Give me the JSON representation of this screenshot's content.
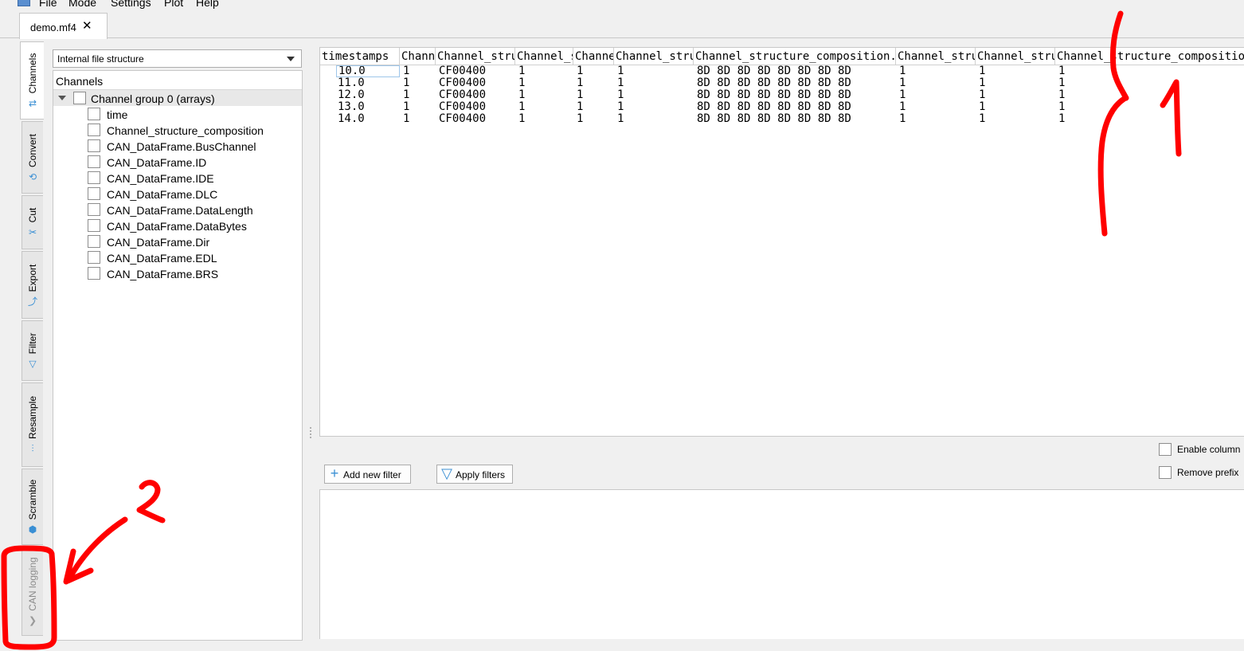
{
  "menu": {
    "items": [
      "File",
      "Mode",
      "Settings",
      "Plot",
      "Help"
    ]
  },
  "document_tab": {
    "title": "demo.mf4",
    "close_glyph": "✕"
  },
  "side_tabs": [
    {
      "label": "Channels",
      "icon": "channels-icon",
      "glyph": "⇄"
    },
    {
      "label": "Convert",
      "icon": "convert-icon",
      "glyph": "⟲"
    },
    {
      "label": "Cut",
      "icon": "scissors-icon",
      "glyph": "✂"
    },
    {
      "label": "Export",
      "icon": "export-icon",
      "glyph": "⤴"
    },
    {
      "label": "Filter",
      "icon": "filter-icon",
      "glyph": "▽"
    },
    {
      "label": "Resample",
      "icon": "resample-icon",
      "glyph": "⫶"
    },
    {
      "label": "Scramble",
      "icon": "scramble-icon",
      "glyph": "⬢"
    },
    {
      "label": "CAN logging",
      "icon": "chevron-icon",
      "glyph": "❯"
    }
  ],
  "left_panel": {
    "combo_value": "Internal file structure",
    "tree_header": "Channels",
    "group_label": "Channel group 0 (arrays)",
    "channels": [
      "time",
      "Channel_structure_composition",
      "CAN_DataFrame.BusChannel",
      "CAN_DataFrame.ID",
      "CAN_DataFrame.IDE",
      "CAN_DataFrame.DLC",
      "CAN_DataFrame.DataLength",
      "CAN_DataFrame.DataBytes",
      "CAN_DataFrame.Dir",
      "CAN_DataFrame.EDL",
      "CAN_DataFrame.BRS"
    ]
  },
  "table": {
    "columns": [
      "timestamps",
      "Channel_structure_composition.CAN_DataFrame.BusChannel",
      "Channel_structure_composition.CAN_DataFrame.ID",
      "Channel_structure_composition.CAN_DataFrame.IDE",
      "Channel_structure_composition.CAN_DataFrame.DLC",
      "Channel_structure_composition.CAN_DataFrame.DataLength",
      "Channel_structure_composition.CAN_DataFrame.DataBytes",
      "Channel_structure_composition.CAN_DataFrame.Dir",
      "Channel_structure_composition.CAN_DataFrame.EDL",
      "Channel_structure_composition.CAN_DataFrame.BRS"
    ],
    "rows": [
      [
        "10.0",
        "1",
        "CF00400",
        "1",
        "1",
        "1",
        "8D 8D 8D 8D 8D 8D 8D 8D",
        "1",
        "1",
        "1"
      ],
      [
        "11.0",
        "1",
        "CF00400",
        "1",
        "1",
        "1",
        "8D 8D 8D 8D 8D 8D 8D 8D",
        "1",
        "1",
        "1"
      ],
      [
        "12.0",
        "1",
        "CF00400",
        "1",
        "1",
        "1",
        "8D 8D 8D 8D 8D 8D 8D 8D",
        "1",
        "1",
        "1"
      ],
      [
        "13.0",
        "1",
        "CF00400",
        "1",
        "1",
        "1",
        "8D 8D 8D 8D 8D 8D 8D 8D",
        "1",
        "1",
        "1"
      ],
      [
        "14.0",
        "1",
        "CF00400",
        "1",
        "1",
        "1",
        "8D 8D 8D 8D 8D 8D 8D 8D",
        "1",
        "1",
        "1"
      ]
    ]
  },
  "options": {
    "enable_columns": "Enable column",
    "remove_prefix": "Remove prefix"
  },
  "filters": {
    "add_label": "Add new filter",
    "apply_label": "Apply filters"
  },
  "annotations": {
    "label_1": "1",
    "label_2": "2",
    "color": "#ff0000"
  }
}
